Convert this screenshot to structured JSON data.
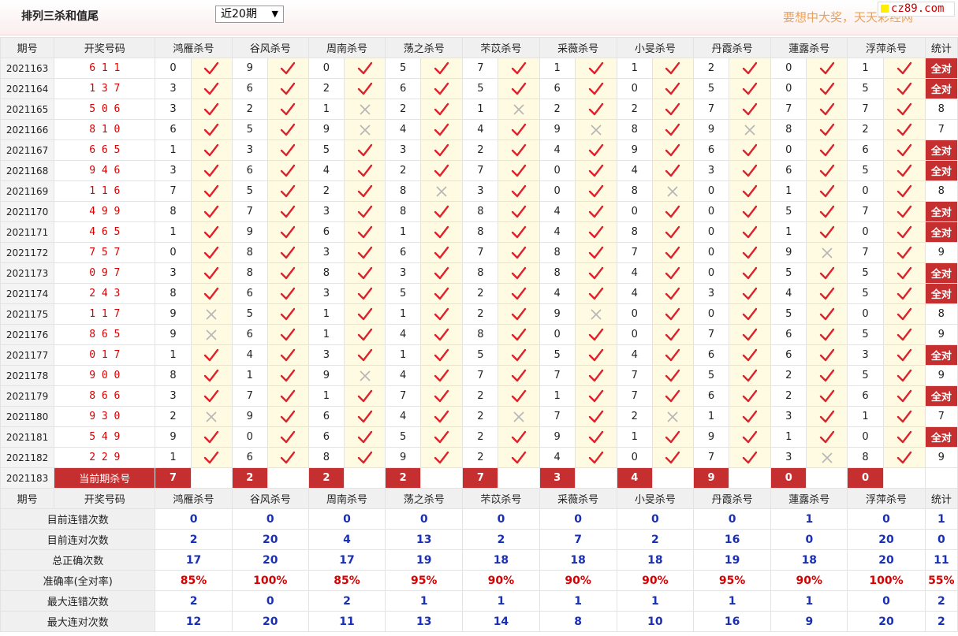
{
  "header": {
    "title": "排列三杀和值尾",
    "period_select": "近20期",
    "slogan": "要想中大奖，天天彩经网",
    "logo": "cz89.com"
  },
  "columns": {
    "period": "期号",
    "draw": "开奖号码",
    "experts": [
      "鸿雁杀号",
      "谷风杀号",
      "周南杀号",
      "荡之杀号",
      "芣苡杀号",
      "采薇杀号",
      "小旻杀号",
      "丹霞杀号",
      "蓮露杀号",
      "浮萍杀号"
    ],
    "stat": "统计"
  },
  "rows": [
    {
      "period": "2021163",
      "draw": "6 1 1",
      "k": [
        [
          "0",
          1
        ],
        [
          "9",
          1
        ],
        [
          "0",
          1
        ],
        [
          "5",
          1
        ],
        [
          "7",
          1
        ],
        [
          "1",
          1
        ],
        [
          "1",
          1
        ],
        [
          "2",
          1
        ],
        [
          "0",
          1
        ],
        [
          "1",
          1
        ]
      ],
      "stat": "全对"
    },
    {
      "period": "2021164",
      "draw": "1 3 7",
      "k": [
        [
          "3",
          1
        ],
        [
          "6",
          1
        ],
        [
          "2",
          1
        ],
        [
          "6",
          1
        ],
        [
          "5",
          1
        ],
        [
          "6",
          1
        ],
        [
          "0",
          1
        ],
        [
          "5",
          1
        ],
        [
          "0",
          1
        ],
        [
          "5",
          1
        ]
      ],
      "stat": "全对"
    },
    {
      "period": "2021165",
      "draw": "5 0 6",
      "k": [
        [
          "3",
          1
        ],
        [
          "2",
          1
        ],
        [
          "1",
          0
        ],
        [
          "2",
          1
        ],
        [
          "1",
          0
        ],
        [
          "2",
          1
        ],
        [
          "2",
          1
        ],
        [
          "7",
          1
        ],
        [
          "7",
          1
        ],
        [
          "7",
          1
        ]
      ],
      "stat": "8"
    },
    {
      "period": "2021166",
      "draw": "8 1 0",
      "k": [
        [
          "6",
          1
        ],
        [
          "5",
          1
        ],
        [
          "9",
          0
        ],
        [
          "4",
          1
        ],
        [
          "4",
          1
        ],
        [
          "9",
          0
        ],
        [
          "8",
          1
        ],
        [
          "9",
          0
        ],
        [
          "8",
          1
        ],
        [
          "2",
          1
        ]
      ],
      "stat": "7"
    },
    {
      "period": "2021167",
      "draw": "6 6 5",
      "k": [
        [
          "1",
          1
        ],
        [
          "3",
          1
        ],
        [
          "5",
          1
        ],
        [
          "3",
          1
        ],
        [
          "2",
          1
        ],
        [
          "4",
          1
        ],
        [
          "9",
          1
        ],
        [
          "6",
          1
        ],
        [
          "0",
          1
        ],
        [
          "6",
          1
        ]
      ],
      "stat": "全对"
    },
    {
      "period": "2021168",
      "draw": "9 4 6",
      "k": [
        [
          "3",
          1
        ],
        [
          "6",
          1
        ],
        [
          "4",
          1
        ],
        [
          "2",
          1
        ],
        [
          "7",
          1
        ],
        [
          "0",
          1
        ],
        [
          "4",
          1
        ],
        [
          "3",
          1
        ],
        [
          "6",
          1
        ],
        [
          "5",
          1
        ]
      ],
      "stat": "全对"
    },
    {
      "period": "2021169",
      "draw": "1 1 6",
      "k": [
        [
          "7",
          1
        ],
        [
          "5",
          1
        ],
        [
          "2",
          1
        ],
        [
          "8",
          0
        ],
        [
          "3",
          1
        ],
        [
          "0",
          1
        ],
        [
          "8",
          0
        ],
        [
          "0",
          1
        ],
        [
          "1",
          1
        ],
        [
          "0",
          1
        ]
      ],
      "stat": "8"
    },
    {
      "period": "2021170",
      "draw": "4 9 9",
      "k": [
        [
          "8",
          1
        ],
        [
          "7",
          1
        ],
        [
          "3",
          1
        ],
        [
          "8",
          1
        ],
        [
          "8",
          1
        ],
        [
          "4",
          1
        ],
        [
          "0",
          1
        ],
        [
          "0",
          1
        ],
        [
          "5",
          1
        ],
        [
          "7",
          1
        ]
      ],
      "stat": "全对"
    },
    {
      "period": "2021171",
      "draw": "4 6 5",
      "k": [
        [
          "1",
          1
        ],
        [
          "9",
          1
        ],
        [
          "6",
          1
        ],
        [
          "1",
          1
        ],
        [
          "8",
          1
        ],
        [
          "4",
          1
        ],
        [
          "8",
          1
        ],
        [
          "0",
          1
        ],
        [
          "1",
          1
        ],
        [
          "0",
          1
        ]
      ],
      "stat": "全对"
    },
    {
      "period": "2021172",
      "draw": "7 5 7",
      "k": [
        [
          "0",
          1
        ],
        [
          "8",
          1
        ],
        [
          "3",
          1
        ],
        [
          "6",
          1
        ],
        [
          "7",
          1
        ],
        [
          "8",
          1
        ],
        [
          "7",
          1
        ],
        [
          "0",
          1
        ],
        [
          "9",
          0
        ],
        [
          "7",
          1
        ]
      ],
      "stat": "9"
    },
    {
      "period": "2021173",
      "draw": "0 9 7",
      "k": [
        [
          "3",
          1
        ],
        [
          "8",
          1
        ],
        [
          "8",
          1
        ],
        [
          "3",
          1
        ],
        [
          "8",
          1
        ],
        [
          "8",
          1
        ],
        [
          "4",
          1
        ],
        [
          "0",
          1
        ],
        [
          "5",
          1
        ],
        [
          "5",
          1
        ]
      ],
      "stat": "全对"
    },
    {
      "period": "2021174",
      "draw": "2 4 3",
      "k": [
        [
          "8",
          1
        ],
        [
          "6",
          1
        ],
        [
          "3",
          1
        ],
        [
          "5",
          1
        ],
        [
          "2",
          1
        ],
        [
          "4",
          1
        ],
        [
          "4",
          1
        ],
        [
          "3",
          1
        ],
        [
          "4",
          1
        ],
        [
          "5",
          1
        ]
      ],
      "stat": "全对"
    },
    {
      "period": "2021175",
      "draw": "1 1 7",
      "k": [
        [
          "9",
          0
        ],
        [
          "5",
          1
        ],
        [
          "1",
          1
        ],
        [
          "1",
          1
        ],
        [
          "2",
          1
        ],
        [
          "9",
          0
        ],
        [
          "0",
          1
        ],
        [
          "0",
          1
        ],
        [
          "5",
          1
        ],
        [
          "0",
          1
        ]
      ],
      "stat": "8"
    },
    {
      "period": "2021176",
      "draw": "8 6 5",
      "k": [
        [
          "9",
          0
        ],
        [
          "6",
          1
        ],
        [
          "1",
          1
        ],
        [
          "4",
          1
        ],
        [
          "8",
          1
        ],
        [
          "0",
          1
        ],
        [
          "0",
          1
        ],
        [
          "7",
          1
        ],
        [
          "6",
          1
        ],
        [
          "5",
          1
        ]
      ],
      "stat": "9"
    },
    {
      "period": "2021177",
      "draw": "0 1 7",
      "k": [
        [
          "1",
          1
        ],
        [
          "4",
          1
        ],
        [
          "3",
          1
        ],
        [
          "1",
          1
        ],
        [
          "5",
          1
        ],
        [
          "5",
          1
        ],
        [
          "4",
          1
        ],
        [
          "6",
          1
        ],
        [
          "6",
          1
        ],
        [
          "3",
          1
        ]
      ],
      "stat": "全对"
    },
    {
      "period": "2021178",
      "draw": "9 0 0",
      "k": [
        [
          "8",
          1
        ],
        [
          "1",
          1
        ],
        [
          "9",
          0
        ],
        [
          "4",
          1
        ],
        [
          "7",
          1
        ],
        [
          "7",
          1
        ],
        [
          "7",
          1
        ],
        [
          "5",
          1
        ],
        [
          "2",
          1
        ],
        [
          "5",
          1
        ]
      ],
      "stat": "9"
    },
    {
      "period": "2021179",
      "draw": "8 6 6",
      "k": [
        [
          "3",
          1
        ],
        [
          "7",
          1
        ],
        [
          "1",
          1
        ],
        [
          "7",
          1
        ],
        [
          "2",
          1
        ],
        [
          "1",
          1
        ],
        [
          "7",
          1
        ],
        [
          "6",
          1
        ],
        [
          "2",
          1
        ],
        [
          "6",
          1
        ]
      ],
      "stat": "全对"
    },
    {
      "period": "2021180",
      "draw": "9 3 0",
      "k": [
        [
          "2",
          0
        ],
        [
          "9",
          1
        ],
        [
          "6",
          1
        ],
        [
          "4",
          1
        ],
        [
          "2",
          0
        ],
        [
          "7",
          1
        ],
        [
          "2",
          0
        ],
        [
          "1",
          1
        ],
        [
          "3",
          1
        ],
        [
          "1",
          1
        ]
      ],
      "stat": "7"
    },
    {
      "period": "2021181",
      "draw": "5 4 9",
      "k": [
        [
          "9",
          1
        ],
        [
          "0",
          1
        ],
        [
          "6",
          1
        ],
        [
          "5",
          1
        ],
        [
          "2",
          1
        ],
        [
          "9",
          1
        ],
        [
          "1",
          1
        ],
        [
          "9",
          1
        ],
        [
          "1",
          1
        ],
        [
          "0",
          1
        ]
      ],
      "stat": "全对"
    },
    {
      "period": "2021182",
      "draw": "2 2 9",
      "k": [
        [
          "1",
          1
        ],
        [
          "6",
          1
        ],
        [
          "8",
          1
        ],
        [
          "9",
          1
        ],
        [
          "2",
          1
        ],
        [
          "4",
          1
        ],
        [
          "0",
          1
        ],
        [
          "7",
          1
        ],
        [
          "3",
          0
        ],
        [
          "8",
          1
        ]
      ],
      "stat": "9"
    }
  ],
  "current": {
    "period": "2021183",
    "label": "当前期杀号",
    "predictions": [
      "7",
      "2",
      "2",
      "2",
      "7",
      "3",
      "4",
      "9",
      "0",
      "0"
    ]
  },
  "summary": [
    {
      "label": "目前连错次数",
      "values": [
        "0",
        "0",
        "0",
        "0",
        "0",
        "0",
        "0",
        "0",
        "1",
        "0"
      ],
      "stat": "1",
      "color": "blue"
    },
    {
      "label": "目前连对次数",
      "values": [
        "2",
        "20",
        "4",
        "13",
        "2",
        "7",
        "2",
        "16",
        "0",
        "20"
      ],
      "stat": "0",
      "color": "blue"
    },
    {
      "label": "总正确次数",
      "values": [
        "17",
        "20",
        "17",
        "19",
        "18",
        "18",
        "18",
        "19",
        "18",
        "20"
      ],
      "stat": "11",
      "color": "blue"
    },
    {
      "label": "准确率(全对率)",
      "values": [
        "85%",
        "100%",
        "85%",
        "95%",
        "90%",
        "90%",
        "90%",
        "95%",
        "90%",
        "100%"
      ],
      "stat": "55%",
      "color": "red"
    },
    {
      "label": "最大连错次数",
      "values": [
        "2",
        "0",
        "2",
        "1",
        "1",
        "1",
        "1",
        "1",
        "1",
        "0"
      ],
      "stat": "2",
      "color": "blue"
    },
    {
      "label": "最大连对次数",
      "values": [
        "12",
        "20",
        "11",
        "13",
        "14",
        "8",
        "10",
        "16",
        "9",
        "20"
      ],
      "stat": "2",
      "color": "blue"
    }
  ],
  "colors": {
    "accent": "#c62f2f",
    "check": "#e0212b",
    "cross": "#b5b5b5",
    "value_blue": "#1a2fb8",
    "value_red": "#d80000"
  }
}
